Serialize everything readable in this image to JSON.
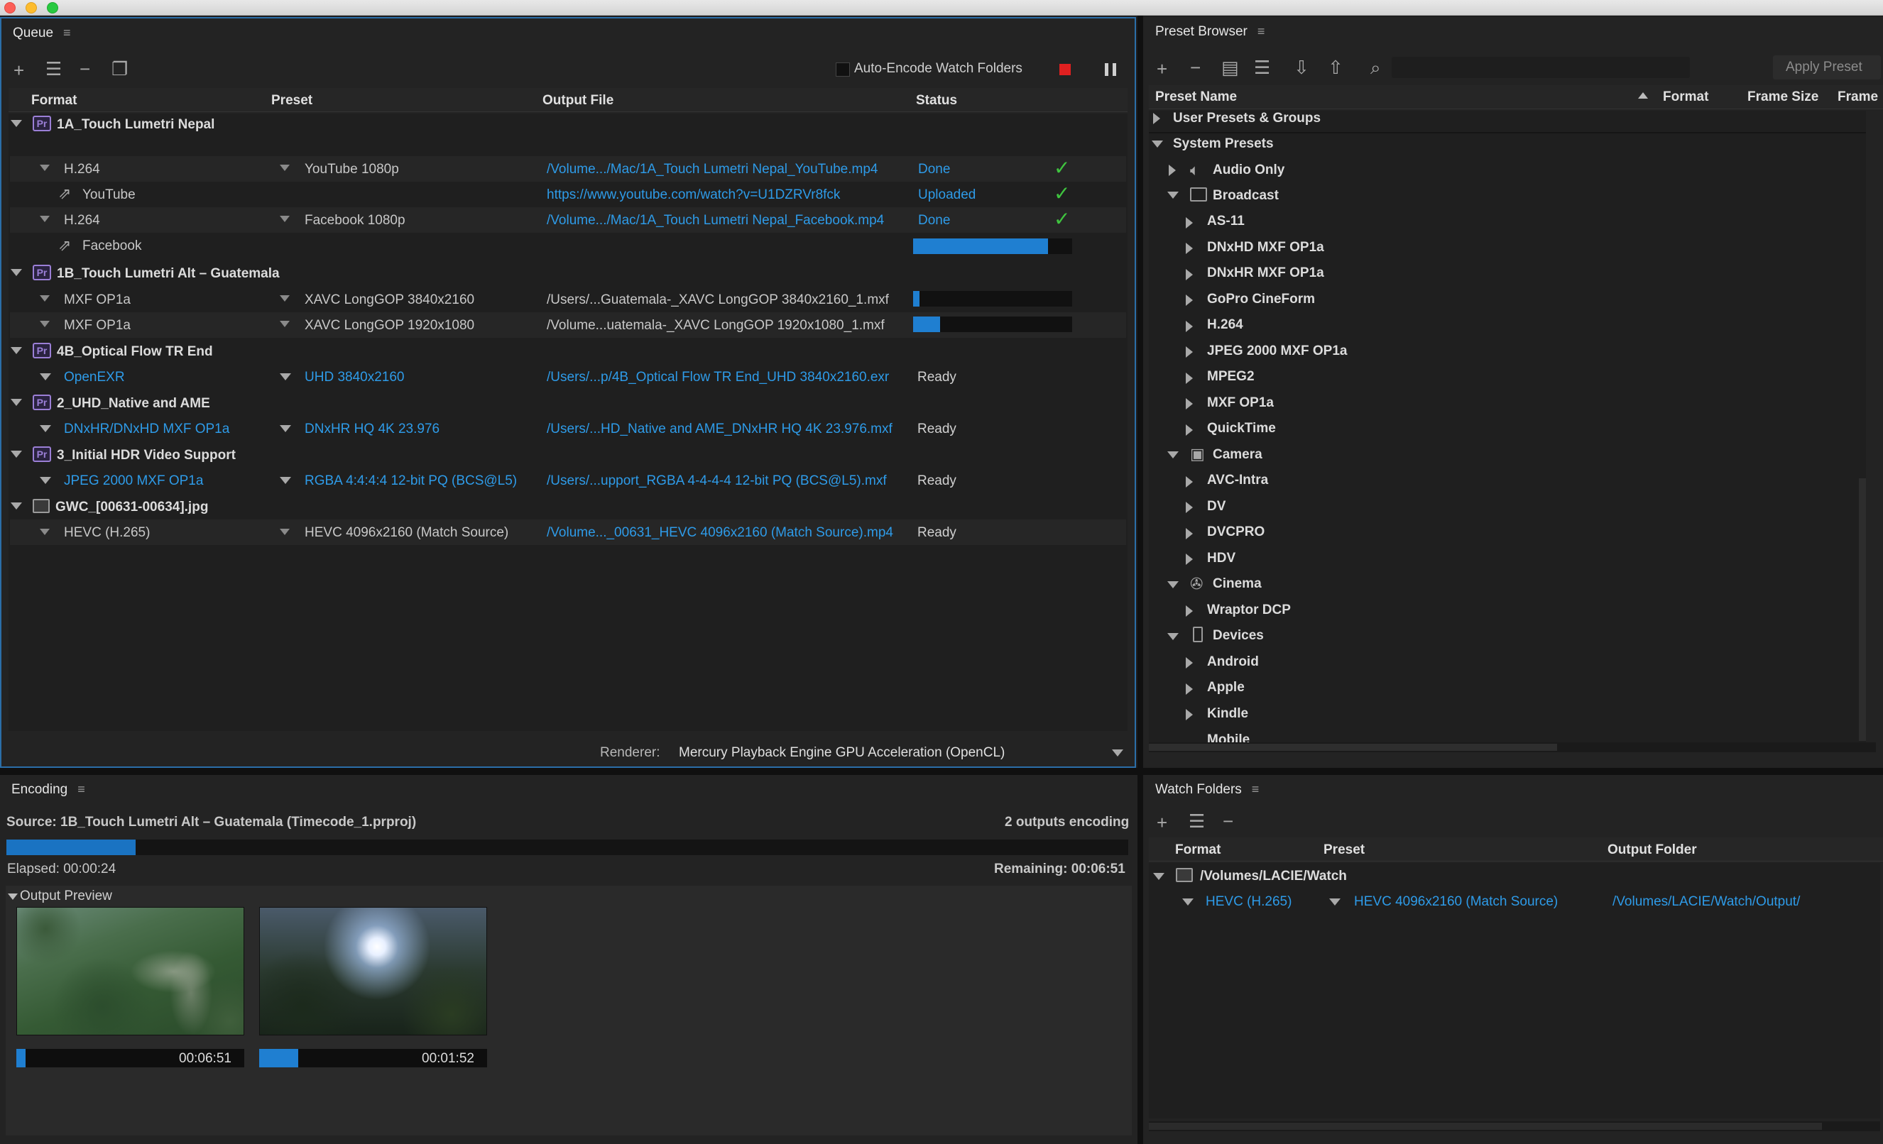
{
  "queue": {
    "tab_label": "Queue",
    "auto_encode_label": "Auto-Encode Watch Folders",
    "columns": [
      "Format",
      "Preset",
      "Output File",
      "Status"
    ],
    "renderer_label": "Renderer:",
    "renderer_value": "Mercury Playback Engine GPU Acceleration (OpenCL)",
    "groups": [
      {
        "name": "1A_Touch Lumetri Nepal",
        "source_icon": "premiere-icon"
      },
      {
        "name": "1B_Touch Lumetri Alt – Guatemala",
        "source_icon": "premiere-icon"
      },
      {
        "name": "4B_Optical Flow TR End",
        "source_icon": "premiere-icon"
      },
      {
        "name": "2_UHD_Native and AME",
        "source_icon": "premiere-icon"
      },
      {
        "name": "3_Initial HDR Video Support",
        "source_icon": "premiere-icon"
      },
      {
        "name": "GWC_[00631-00634].jpg",
        "source_icon": "image-sequence-icon"
      }
    ],
    "items": [
      {
        "format": "H.264",
        "preset": "YouTube 1080p",
        "output": "/Volume.../Mac/1A_Touch Lumetri Nepal_YouTube.mp4",
        "status": "Done"
      },
      {
        "format": "YouTube",
        "output": "https://www.youtube.com/watch?v=U1DZRVr8fck",
        "status": "Uploaded"
      },
      {
        "format": "H.264",
        "preset": "Facebook 1080p",
        "output": "/Volume.../Mac/1A_Touch Lumetri Nepal_Facebook.mp4",
        "status": "Done"
      },
      {
        "format": "Facebook",
        "progress": 0.85
      },
      {
        "format": "MXF OP1a",
        "preset": "XAVC LongGOP 3840x2160",
        "output": "/Users/...Guatemala-_XAVC LongGOP 3840x2160_1.mxf",
        "progress": 0.04
      },
      {
        "format": "MXF OP1a",
        "preset": "XAVC LongGOP 1920x1080",
        "output": "/Volume...uatemala-_XAVC LongGOP 1920x1080_1.mxf",
        "progress": 0.17
      },
      {
        "format": "OpenEXR",
        "preset": "UHD 3840x2160",
        "output": "/Users/...p/4B_Optical Flow TR End_UHD 3840x2160.exr",
        "status": "Ready"
      },
      {
        "format": "DNxHR/DNxHD MXF OP1a",
        "preset": "DNxHR HQ 4K 23.976",
        "output": "/Users/...HD_Native and AME_DNxHR HQ 4K 23.976.mxf",
        "status": "Ready"
      },
      {
        "format": "JPEG 2000 MXF OP1a",
        "preset": "RGBA 4:4:4:4 12-bit PQ (BCS@L5)",
        "output": "/Users/...upport_RGBA 4-4-4-4 12-bit PQ (BCS@L5).mxf",
        "status": "Ready"
      },
      {
        "format": "HEVC (H.265)",
        "preset": "HEVC 4096x2160 (Match Source)",
        "output": "/Volume..._00631_HEVC 4096x2160 (Match Source).mp4",
        "status": "Ready"
      }
    ]
  },
  "preset_browser": {
    "tab_label": "Preset Browser",
    "apply_label": "Apply Preset",
    "columns": [
      "Preset Name",
      "Format",
      "Frame Size",
      "Frame"
    ],
    "tree": [
      "User Presets & Groups",
      "System Presets",
      "Audio Only",
      "Broadcast",
      "AS-11",
      "DNxHD MXF OP1a",
      "DNxHR MXF OP1a",
      "GoPro CineForm",
      "H.264",
      "JPEG 2000 MXF OP1a",
      "MPEG2",
      "MXF OP1a",
      "QuickTime",
      "Camera",
      "AVC-Intra",
      "DV",
      "DVCPRO",
      "HDV",
      "Cinema",
      "Wraptor DCP",
      "Devices",
      "Android",
      "Apple",
      "Kindle",
      "Mobile"
    ]
  },
  "encoding": {
    "tab_label": "Encoding",
    "source": "Source: 1B_Touch Lumetri Alt – Guatemala  (Timecode_1.prproj)",
    "outputs": "2 outputs encoding",
    "progress": 0.115,
    "elapsed": "Elapsed: 00:00:24",
    "remaining": "Remaining: 00:06:51",
    "preview_label": "Output Preview",
    "previews": [
      {
        "time": "00:06:51",
        "progress": 0.04
      },
      {
        "time": "00:01:52",
        "progress": 0.17
      }
    ]
  },
  "watch_folders": {
    "tab_label": "Watch Folders",
    "columns": [
      "Format",
      "Preset",
      "Output Folder"
    ],
    "folder": "/Volumes/LACIE/Watch",
    "format": "HEVC (H.265)",
    "preset": "HEVC 4096x2160 (Match Source)",
    "output": "/Volumes/LACIE/Watch/Output/"
  },
  "colors": {
    "accent": "#2e9be8",
    "progress": "#1f7fd1",
    "done": "#3fc43f",
    "stop": "#e02020"
  }
}
